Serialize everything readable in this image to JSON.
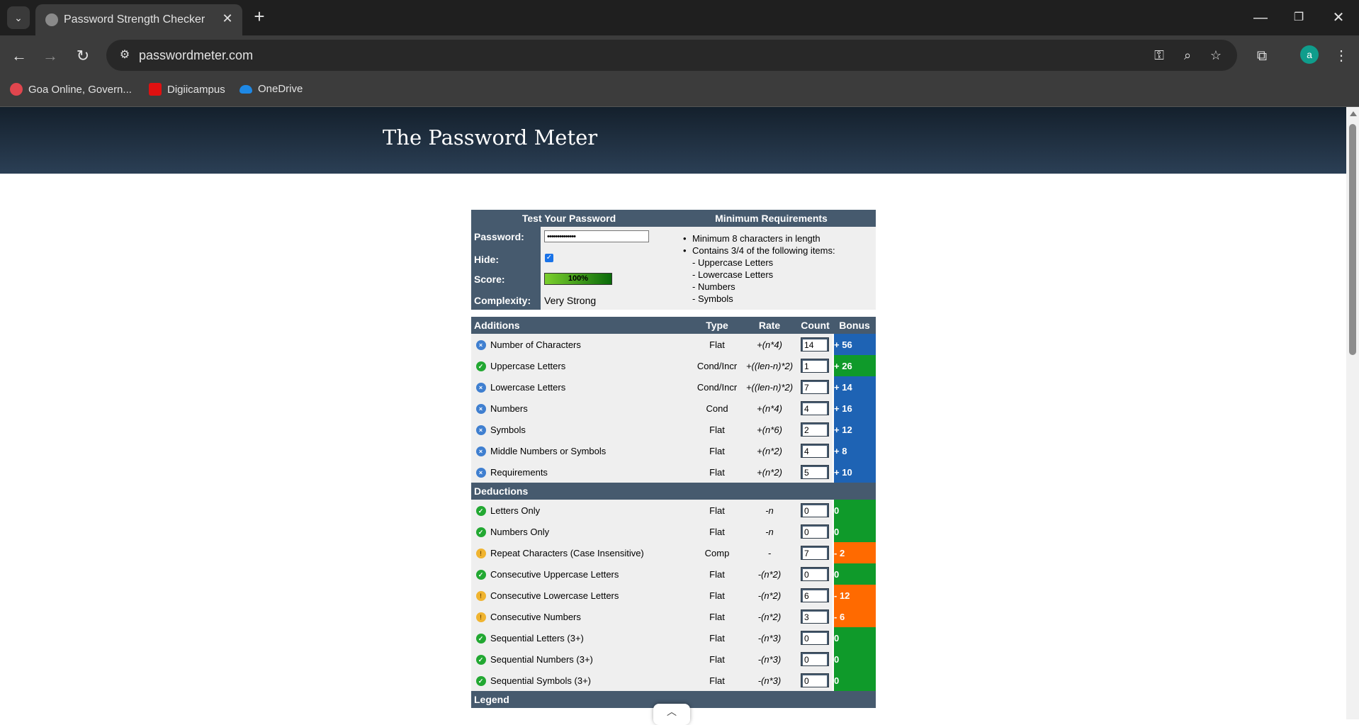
{
  "browser": {
    "tab_title": "Password Strength Checker",
    "url": "passwordmeter.com",
    "avatar_letter": "a",
    "bookmarks": [
      "Goa Online, Govern...",
      "Digiicampus",
      "OneDrive"
    ]
  },
  "page": {
    "title": "The Password Meter",
    "test_header": "Test Your Password",
    "req_header": "Minimum Requirements",
    "labels": {
      "password": "Password:",
      "hide": "Hide:",
      "score": "Score:",
      "complexity": "Complexity:"
    },
    "password_masked": "••••••••••••••",
    "hide_checked": true,
    "score_percent": 100,
    "score_text": "100%",
    "complexity": "Very Strong",
    "requirements": [
      "Minimum 8 characters in length",
      "Contains 3/4 of the following items:"
    ],
    "requirement_items": [
      "- Uppercase Letters",
      "- Lowercase Letters",
      "- Numbers",
      "- Symbols"
    ]
  },
  "additions": {
    "header": "Additions",
    "columns": [
      "Type",
      "Rate",
      "Count",
      "Bonus"
    ],
    "rows": [
      {
        "status": "cross",
        "name": "Number of Characters",
        "type": "Flat",
        "rate": "+(n*4)",
        "count": "14",
        "bonus": "+ 56",
        "color": "blue"
      },
      {
        "status": "check",
        "name": "Uppercase Letters",
        "type": "Cond/Incr",
        "rate": "+((len-n)*2)",
        "count": "1",
        "bonus": "+ 26",
        "color": "green"
      },
      {
        "status": "cross",
        "name": "Lowercase Letters",
        "type": "Cond/Incr",
        "rate": "+((len-n)*2)",
        "count": "7",
        "bonus": "+ 14",
        "color": "blue"
      },
      {
        "status": "cross",
        "name": "Numbers",
        "type": "Cond",
        "rate": "+(n*4)",
        "count": "4",
        "bonus": "+ 16",
        "color": "blue"
      },
      {
        "status": "cross",
        "name": "Symbols",
        "type": "Flat",
        "rate": "+(n*6)",
        "count": "2",
        "bonus": "+ 12",
        "color": "blue"
      },
      {
        "status": "cross",
        "name": "Middle Numbers or Symbols",
        "type": "Flat",
        "rate": "+(n*2)",
        "count": "4",
        "bonus": "+ 8",
        "color": "blue"
      },
      {
        "status": "cross",
        "name": "Requirements",
        "type": "Flat",
        "rate": "+(n*2)",
        "count": "5",
        "bonus": "+ 10",
        "color": "blue"
      }
    ]
  },
  "deductions": {
    "header": "Deductions",
    "rows": [
      {
        "status": "check",
        "name": "Letters Only",
        "type": "Flat",
        "rate": "-n",
        "count": "0",
        "bonus": "0",
        "color": "green"
      },
      {
        "status": "check",
        "name": "Numbers Only",
        "type": "Flat",
        "rate": "-n",
        "count": "0",
        "bonus": "0",
        "color": "green"
      },
      {
        "status": "warn",
        "name": "Repeat Characters (Case Insensitive)",
        "type": "Comp",
        "rate": "-",
        "count": "7",
        "bonus": "- 2",
        "color": "orange"
      },
      {
        "status": "check",
        "name": "Consecutive Uppercase Letters",
        "type": "Flat",
        "rate": "-(n*2)",
        "count": "0",
        "bonus": "0",
        "color": "green"
      },
      {
        "status": "warn",
        "name": "Consecutive Lowercase Letters",
        "type": "Flat",
        "rate": "-(n*2)",
        "count": "6",
        "bonus": "- 12",
        "color": "orange"
      },
      {
        "status": "warn",
        "name": "Consecutive Numbers",
        "type": "Flat",
        "rate": "-(n*2)",
        "count": "3",
        "bonus": "- 6",
        "color": "orange"
      },
      {
        "status": "check",
        "name": "Sequential Letters (3+)",
        "type": "Flat",
        "rate": "-(n*3)",
        "count": "0",
        "bonus": "0",
        "color": "green"
      },
      {
        "status": "check",
        "name": "Sequential Numbers (3+)",
        "type": "Flat",
        "rate": "-(n*3)",
        "count": "0",
        "bonus": "0",
        "color": "green"
      },
      {
        "status": "check",
        "name": "Sequential Symbols (3+)",
        "type": "Flat",
        "rate": "-(n*3)",
        "count": "0",
        "bonus": "0",
        "color": "green"
      }
    ]
  },
  "legend": {
    "header": "Legend"
  },
  "colors": {
    "header_bar": "#465a6e",
    "bonus_blue": "#1e63b4",
    "bonus_green": "#0f9a2a",
    "bonus_orange": "#ff6a00"
  }
}
